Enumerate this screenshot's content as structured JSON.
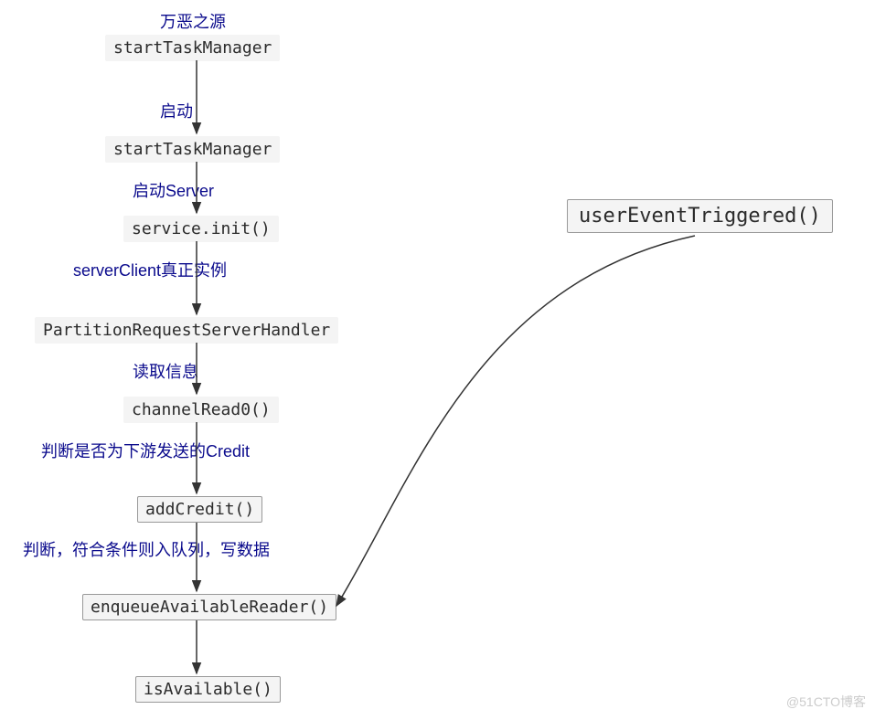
{
  "chart_data": {
    "type": "flowchart",
    "nodes": [
      {
        "id": "n1",
        "label": "startTaskManager",
        "annotation": "万恶之源"
      },
      {
        "id": "n2",
        "label": "startTaskManager",
        "annotation": "启动"
      },
      {
        "id": "n3",
        "label": "service.init()",
        "annotation": "启动Server"
      },
      {
        "id": "n4",
        "label": "PartitionRequestServerHandler",
        "annotation": "serverClient真正实例"
      },
      {
        "id": "n5",
        "label": "channelRead0()",
        "annotation": "读取信息"
      },
      {
        "id": "n6",
        "label": "addCredit()",
        "annotation": "判断是否为下游发送的Credit",
        "boxed": true
      },
      {
        "id": "n7",
        "label": "enqueueAvailableReader()",
        "annotation": "判断，符合条件则入队列，写数据",
        "boxed": true
      },
      {
        "id": "n8",
        "label": "isAvailable()",
        "boxed": true
      },
      {
        "id": "n9",
        "label": "userEventTriggered()",
        "boxed": true
      }
    ],
    "edges": [
      {
        "from": "n1",
        "to": "n2"
      },
      {
        "from": "n2",
        "to": "n3"
      },
      {
        "from": "n3",
        "to": "n4"
      },
      {
        "from": "n4",
        "to": "n5"
      },
      {
        "from": "n5",
        "to": "n6"
      },
      {
        "from": "n6",
        "to": "n7"
      },
      {
        "from": "n7",
        "to": "n8"
      },
      {
        "from": "n9",
        "to": "n7"
      }
    ]
  },
  "labels": {
    "l1": "万恶之源",
    "l2": "启动",
    "l3": "启动Server",
    "l4": "serverClient真正实例",
    "l5": "读取信息",
    "l6": "判断是否为下游发送的Credit",
    "l7": "判断，符合条件则入队列，写数据"
  },
  "nodes": {
    "n1": "startTaskManager",
    "n2": "startTaskManager",
    "n3": "service.init()",
    "n4": "PartitionRequestServerHandler",
    "n5": "channelRead0()",
    "n6": "addCredit()",
    "n7": "enqueueAvailableReader()",
    "n8": "isAvailable()",
    "n9": "userEventTriggered()"
  },
  "watermark": "@51CTO博客"
}
